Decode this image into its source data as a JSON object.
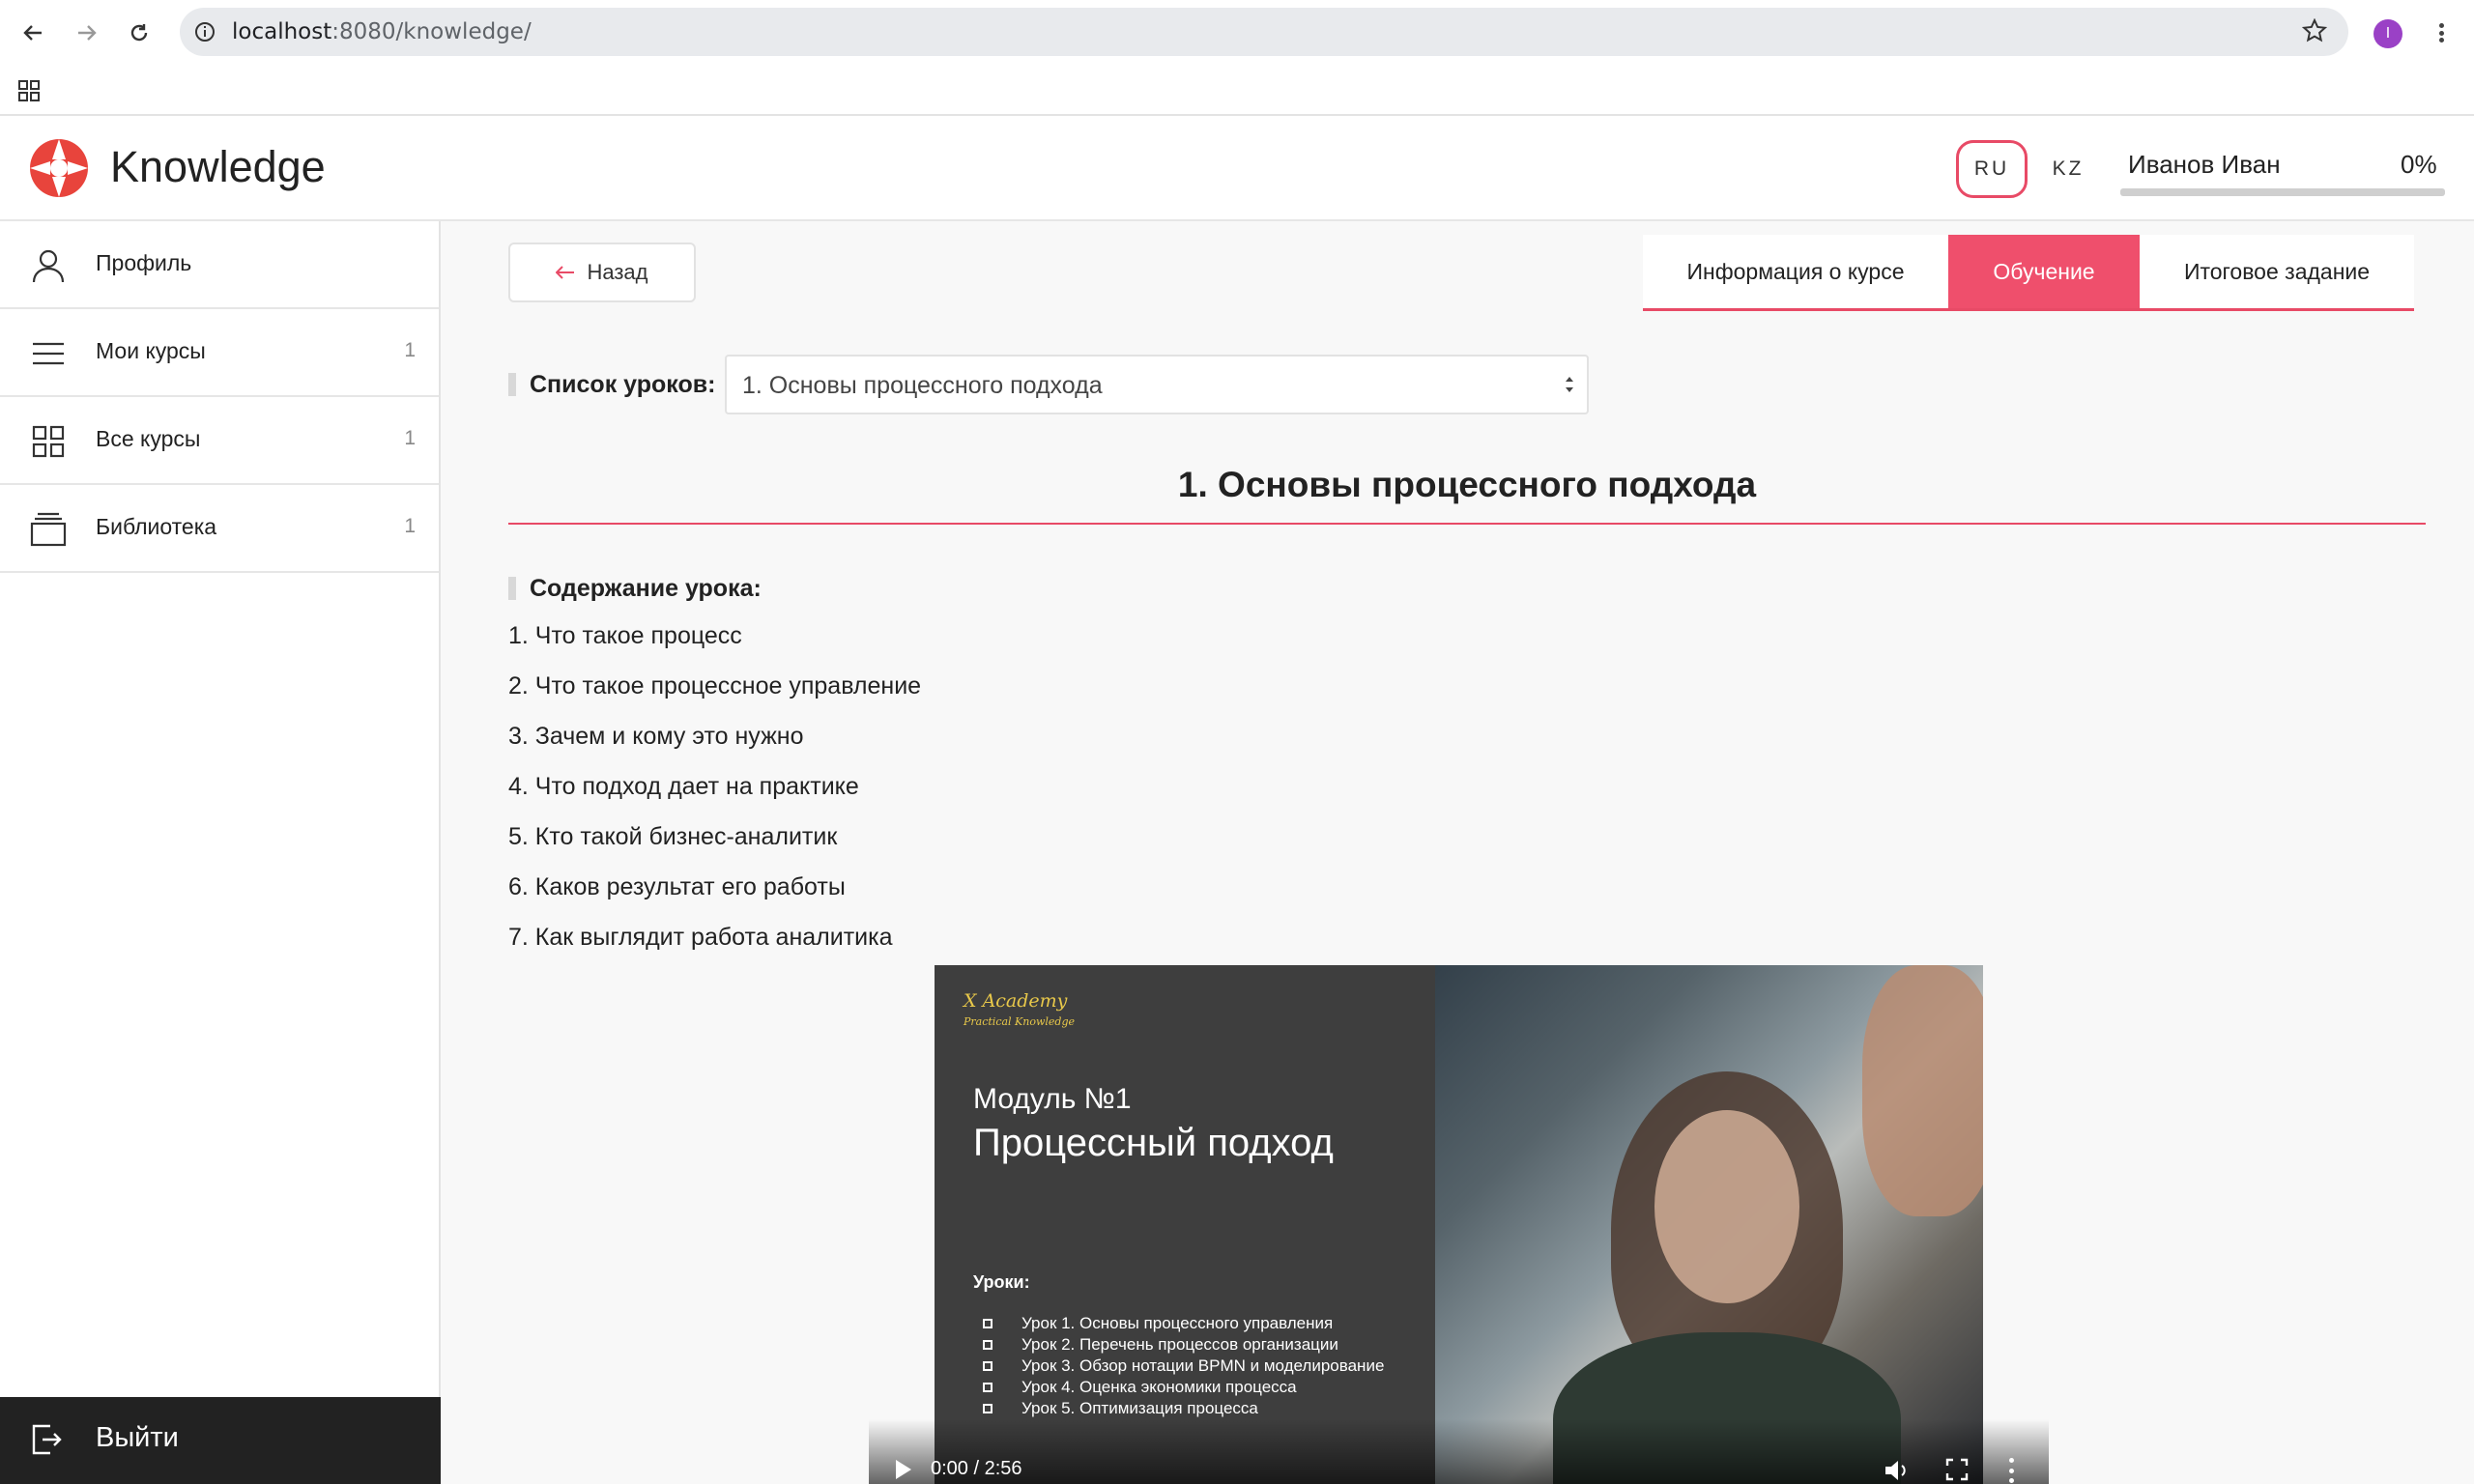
{
  "browser": {
    "url_host": "localhost",
    "url_rest": ":8080/knowledge/",
    "profile_initial": "I"
  },
  "header": {
    "app_title": "Knowledge",
    "lang_ru": "RU",
    "lang_kz": "KZ",
    "user_name": "Иванов Иван",
    "progress_text": "0%",
    "progress_value": 0,
    "accent_color": "#e84a66"
  },
  "sidebar": {
    "items": [
      {
        "label": "Профиль",
        "count": "",
        "icon": "user-icon"
      },
      {
        "label": "Мои курсы",
        "count": "1",
        "icon": "list-icon"
      },
      {
        "label": "Все курсы",
        "count": "1",
        "icon": "grid-icon"
      },
      {
        "label": "Библиотека",
        "count": "1",
        "icon": "library-icon"
      }
    ],
    "logout_label": "Выйти"
  },
  "main": {
    "back_label": "Назад",
    "tabs": [
      {
        "label": "Информация о курсе",
        "active": false
      },
      {
        "label": "Обучение",
        "active": true
      },
      {
        "label": "Итоговое задание",
        "active": false
      }
    ],
    "lessons_label": "Список уроков:",
    "lessons_selected": "1. Основы процессного подхода",
    "lesson_title": "1. Основы процессного подхода",
    "content_label": "Содержание урока:",
    "content_items": [
      "1. Что такое процесс",
      "2. Что такое процессное управление",
      "3. Зачем и кому это нужно",
      "4. Что подход дает на практике",
      "5. Кто такой бизнес-аналитик",
      "6. Каков результат его работы",
      "7. Как выглядит работа аналитика"
    ]
  },
  "video": {
    "brand": "X Academy",
    "brand_sub": "Practical Knowledge",
    "module_no": "Модуль №1",
    "module_name": "Процессный подход",
    "lessons_heading": "Уроки:",
    "slide_lessons": [
      "Урок 1. Основы процессного управления",
      "Урок 2. Перечень процессов организации",
      "Урок 3. Обзор нотации BPMN и моделирование",
      "Урок 4. Оценка экономики процесса",
      "Урок 5. Оптимизация процесса"
    ],
    "time": "0:00 / 2:56"
  }
}
